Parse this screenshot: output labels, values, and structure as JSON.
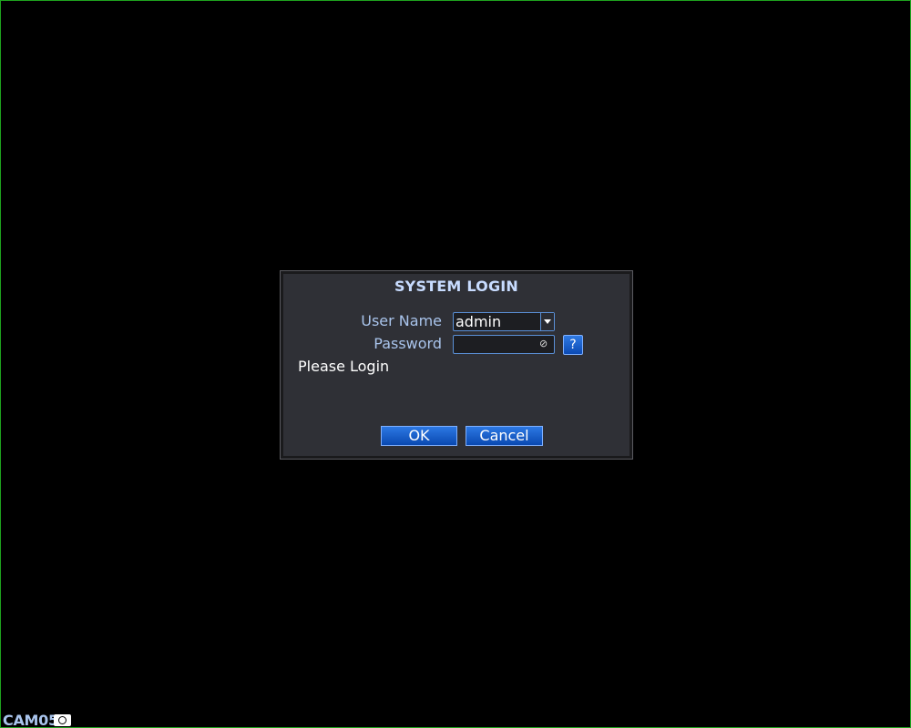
{
  "dialog": {
    "title": "SYSTEM LOGIN",
    "user_name_label": "User Name",
    "user_name_value": "admin",
    "password_label": "Password",
    "password_value": "",
    "help_label": "?",
    "status": "Please Login",
    "ok_label": "OK",
    "cancel_label": "Cancel"
  },
  "camera": {
    "label": "CAM05"
  },
  "icons": {
    "dropdown": "chevron-down-icon",
    "password_visibility": "eye-off-icon",
    "camera": "camera-icon"
  },
  "colors": {
    "background": "#000000",
    "border": "#1fa31f",
    "dialog_bg": "#2f3036",
    "label": "#a9c4ec",
    "button": "#1a5fd0"
  }
}
